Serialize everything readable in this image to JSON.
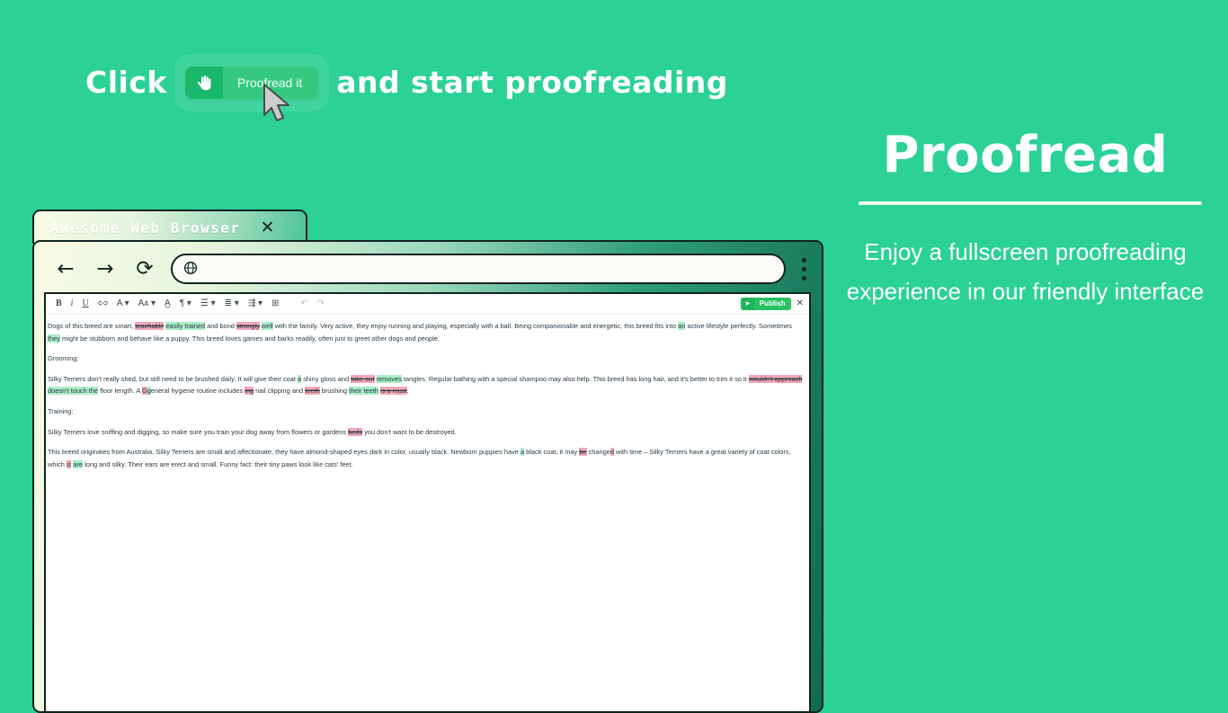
{
  "theme": {
    "bg": "#2bd195",
    "accent_dark": "#10241f",
    "insert_hl": "#a9eec6",
    "delete_hl": "#f7a8b8"
  },
  "callout": {
    "pre_text": "Click",
    "post_text": "and start proofreading",
    "button": {
      "icon": "hand-pointing-icon",
      "icon_glyph": "✋",
      "label": "Proofread it"
    },
    "cursor_icon": "mouse-cursor-icon"
  },
  "right_panel": {
    "title": "Proofread",
    "subtitle": "Enjoy a fullscreen proofreading experience in our friendly interface"
  },
  "browser": {
    "title": "Awesome Web Browser",
    "close_label": "✕",
    "nav": {
      "back": "←",
      "forward": "→",
      "reload": "⟳",
      "menu_icon": "kebab-menu-icon"
    },
    "address_bar": {
      "icon": "globe-icon",
      "icon_glyph": "🌐",
      "value": "",
      "placeholder": ""
    }
  },
  "editor": {
    "toolbar": [
      {
        "name": "bold",
        "glyph": "B"
      },
      {
        "name": "italic",
        "glyph": "i"
      },
      {
        "name": "underline",
        "glyph": "U"
      },
      {
        "name": "link",
        "glyph": "🔗"
      },
      {
        "name": "text-color",
        "glyph": "A ▾"
      },
      {
        "name": "font-size",
        "glyph": "Aᴀ ▾"
      },
      {
        "name": "highlight-color",
        "glyph": "A̲"
      },
      {
        "name": "paragraph-style",
        "glyph": "¶ ▾"
      },
      {
        "name": "bulleted-list",
        "glyph": "☰ ▾"
      },
      {
        "name": "numbered-list",
        "glyph": "≣ ▾"
      },
      {
        "name": "align",
        "glyph": "⇶ ▾"
      },
      {
        "name": "table",
        "glyph": "⊞"
      },
      {
        "name": "undo",
        "glyph": "↶"
      },
      {
        "name": "redo",
        "glyph": "↷"
      }
    ],
    "publish": {
      "icon": "send-icon",
      "icon_glyph": "➤",
      "label": "Publish"
    },
    "close_label": "✕"
  },
  "document": {
    "paragraphs": [
      {
        "id": "p1",
        "runs": [
          {
            "t": "Dogs of this breed are smart, ",
            "k": "n"
          },
          {
            "t": "teachable",
            "k": "d"
          },
          {
            "t": " ",
            "k": "n"
          },
          {
            "t": "easily trained",
            "k": "i"
          },
          {
            "t": " and bond ",
            "k": "n"
          },
          {
            "t": "strongly",
            "k": "d"
          },
          {
            "t": " ",
            "k": "n"
          },
          {
            "t": "well",
            "k": "i"
          },
          {
            "t": " with the family. Very active, they enjoy running and playing, especially with a ball. Being companionable and energetic, this breed fits into ",
            "k": "n"
          },
          {
            "t": "an",
            "k": "i"
          },
          {
            "t": " active lifestyle perfectly. Sometimes ",
            "k": "n"
          },
          {
            "t": "they",
            "k": "i"
          },
          {
            "t": " might be stubborn and behave like a puppy. This breed loves games and barks readily, often just to greet other dogs and people.",
            "k": "n"
          }
        ]
      },
      {
        "id": "p2",
        "runs": [
          {
            "t": "Grooming:",
            "k": "n"
          }
        ]
      },
      {
        "id": "p3",
        "runs": [
          {
            "t": "Silky Terriers don't really shed, but still need to be brushed daily. It will give their coat ",
            "k": "n"
          },
          {
            "t": "a",
            "k": "i"
          },
          {
            "t": " shiny gloss and ",
            "k": "n"
          },
          {
            "t": "take out",
            "k": "d"
          },
          {
            "t": " ",
            "k": "n"
          },
          {
            "t": "removes",
            "k": "i"
          },
          {
            "t": " tangles. Regular bathing with a special shampoo may also help. This breed has long hair, and it's better to trim it so it ",
            "k": "n"
          },
          {
            "t": "wouldn't approach",
            "k": "d"
          },
          {
            "t": " ",
            "k": "n"
          },
          {
            "t": "doesn't touch the",
            "k": "i"
          },
          {
            "t": " floor length. A ",
            "k": "n"
          },
          {
            "t": "G",
            "k": "c"
          },
          {
            "t": "g",
            "k": "i"
          },
          {
            "t": "eneral hygiene routine includes ",
            "k": "n"
          },
          {
            "t": "ing",
            "k": "d"
          },
          {
            "t": " nail clipping and ",
            "k": "n"
          },
          {
            "t": "teeth",
            "k": "d"
          },
          {
            "t": " brushing ",
            "k": "n"
          },
          {
            "t": "their teeth",
            "k": "i"
          },
          {
            "t": " ",
            "k": "n"
          },
          {
            "t": "is a must",
            "k": "d"
          },
          {
            "t": ".",
            "k": "n"
          }
        ]
      },
      {
        "id": "p4",
        "runs": [
          {
            "t": "Training:",
            "k": "n"
          }
        ]
      },
      {
        "id": "p5",
        "runs": [
          {
            "t": "Silky Terriers love sniffing and digging, so make sure you train your dog away from flowers or gardens ",
            "k": "n"
          },
          {
            "t": " ",
            "k": "i"
          },
          {
            "t": "beds",
            "k": "d"
          },
          {
            "t": " you don't want to be destroyed.",
            "k": "n"
          }
        ]
      },
      {
        "id": "p6",
        "runs": [
          {
            "t": "This breed originates from Australia. Silky Terriers are small and affectionate, they have almond-shaped eyes dark in color, usually black. Newborn puppies have ",
            "k": "n"
          },
          {
            "t": "a",
            "k": "i"
          },
          {
            "t": " black coat, it may ",
            "k": "n"
          },
          {
            "t": "be",
            "k": "d"
          },
          {
            "t": " change",
            "k": "n"
          },
          {
            "t": "d",
            "k": "c"
          },
          {
            "t": " with time  – Silky Terriers have a great variety of coat colors, which ",
            "k": "n"
          },
          {
            "t": "is",
            "k": "c"
          },
          {
            "t": " ",
            "k": "n"
          },
          {
            "t": "are",
            "k": "i"
          },
          {
            "t": " long and silky. Their ears are erect and small. Funny fact: their tiny paws look like cats' feet.",
            "k": "n"
          }
        ]
      }
    ]
  }
}
